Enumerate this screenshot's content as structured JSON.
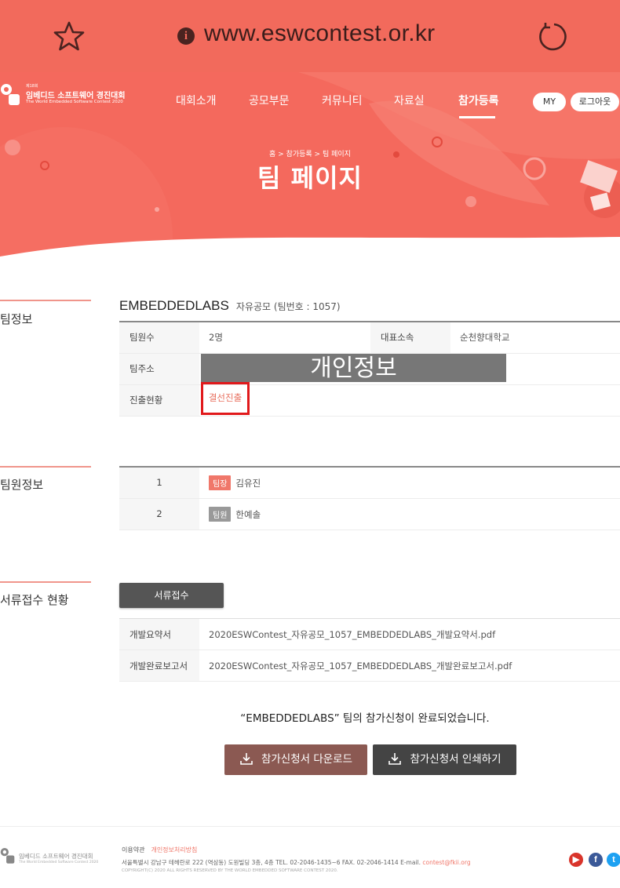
{
  "browser": {
    "url": "www.eswcontest.or.kr"
  },
  "header": {
    "logo": {
      "line1": "제18회",
      "line2": "임베디드 소프트웨어 경진대회",
      "line3": "The World Embedded Software Contest 2020"
    },
    "nav": [
      "대회소개",
      "공모부문",
      "커뮤니티",
      "자료실",
      "참가등록"
    ],
    "active_nav": "참가등록",
    "my_label": "MY",
    "logout_label": "로그아웃",
    "breadcrumb": "홈  >  참가등록  >  팀 페이지",
    "title": "팀 페이지"
  },
  "team_info": {
    "section_label": "팀정보",
    "team_name": "EMBEDDEDLABS",
    "team_sub": "자유공모 (팀번호 : 1057)",
    "members_label": "팀원수",
    "members_value": "2명",
    "affiliation_label": "대표소속",
    "affiliation_value": "순천향대학교",
    "address_label": "팀주소",
    "address_mask": "개인정보",
    "status_label": "진출현황",
    "status_value": "결선진출"
  },
  "members": {
    "section_label": "팀원정보",
    "rows": [
      {
        "no": "1",
        "role": "팀장",
        "name": "김유진"
      },
      {
        "no": "2",
        "role": "팀원",
        "name": "한예솔"
      }
    ]
  },
  "documents": {
    "section_label": "서류접수 현황",
    "button_label": "서류접수",
    "rows": [
      {
        "label": "개발요약서",
        "file": "2020ESWContest_자유공모_1057_EMBEDDEDLABS_개발요약서.pdf"
      },
      {
        "label": "개발완료보고서",
        "file": "2020ESWContest_자유공모_1057_EMBEDDEDLABS_개발완료보고서.pdf"
      }
    ]
  },
  "completion": {
    "message": "“EMBEDDEDLABS” 팀의 참가신청이 완료되었습니다.",
    "download_label": "참가신청서 다운로드",
    "print_label": "참가신청서 인쇄하기"
  },
  "footer": {
    "logo_line2": "임베디드 소프트웨어 경진대회",
    "logo_line3": "The World Embedded Software Contest 2020",
    "terms": "이용약관",
    "privacy_policy": "개인정보처리방침",
    "address": "서울특별시 강남구 테헤란로 222 (역삼동) 도원빌딩 3층, 4층   TEL. 02-2046-1435~6   FAX. 02-2046-1414   E-mail. ",
    "email": "contest@fkii.org",
    "copyright": "COPYRIGHT(C) 2020 ALL RIGHTS RESERVED BY THE WORLD EMBEDDED SOFTWARE CONTEST 2020."
  },
  "colors": {
    "hero": "#f4695d",
    "accent": "#f0776a",
    "download_btn": "#8b5952",
    "print_btn": "#444444"
  }
}
